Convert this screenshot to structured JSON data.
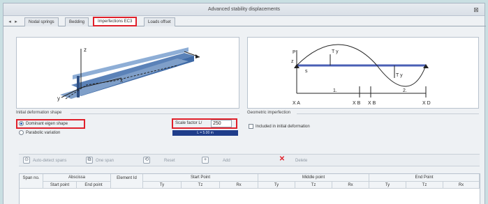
{
  "window": {
    "title": "Advanced stability displacements",
    "close_symbol": "⊠"
  },
  "tabs": [
    {
      "label": "Nodal springs",
      "active": false
    },
    {
      "label": "Bedding",
      "active": false
    },
    {
      "label": "Imperfections EC3",
      "active": true
    },
    {
      "label": "Loads offset",
      "active": false
    }
  ],
  "left_figure": {
    "axis_z": "z",
    "axis_y": "y",
    "axis_x": "x"
  },
  "right_figure": {
    "label_p": "P",
    "label_ty_top": "T y",
    "label_z": "z",
    "label_s": "s",
    "label_ty_bottom": "T y",
    "label_1": "1.",
    "label_2": "2.",
    "label_xa": "X A",
    "label_xb": "X B",
    "label_xd": "X B",
    "label_xc": "X D"
  },
  "initial_shape": {
    "heading": "Initial deformation shape",
    "options": [
      {
        "label": "Dominant eigen shape",
        "selected": true
      },
      {
        "label": "Parabolic variation",
        "selected": false
      }
    ],
    "scale_label": "Scale factor L/",
    "scale_value": "250",
    "info_bar": "L = 5.00 m"
  },
  "geometric": {
    "heading": "Geometric imperfection",
    "checkbox_label": "Included in initial deformation",
    "checked": false
  },
  "toolbar": {
    "buttons": [
      {
        "icon": "auto-detect-icon",
        "symbol": "⊙",
        "label": "Auto-detect spans"
      },
      {
        "icon": "one-span-icon",
        "symbol": "⧉",
        "label": "One span"
      },
      {
        "icon": "reset-icon",
        "symbol": "⟲",
        "label": "Reset"
      },
      {
        "icon": "add-icon",
        "symbol": "+",
        "label": "Add"
      },
      {
        "icon": "delete-icon",
        "symbol": "✕",
        "label": "Delete"
      }
    ]
  },
  "grid": {
    "header_top": {
      "span_no": "Span no.",
      "abscissa": "Abscissa",
      "element_id": "Element Id",
      "start_point": "Start Point",
      "middle_point": "Middle point",
      "end_point": "End Point"
    },
    "header_sub": {
      "start": "Start point",
      "end": "End point",
      "ty": "Ty",
      "tz": "Tz",
      "rx": "Rx"
    }
  }
}
